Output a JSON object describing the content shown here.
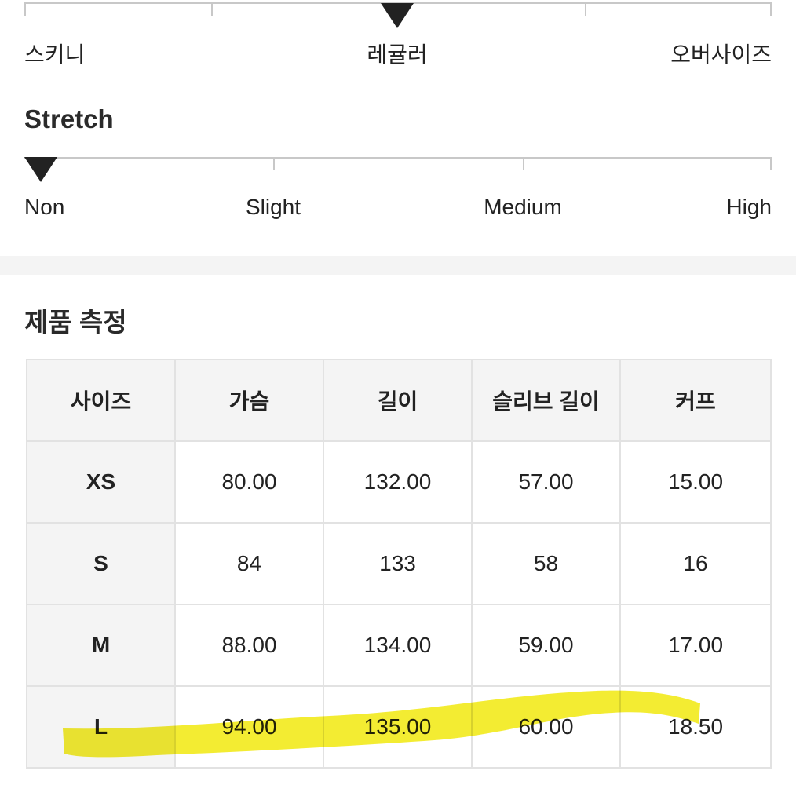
{
  "fit_scale": {
    "labels": [
      "스키니",
      "레귤러",
      "오버사이즈"
    ],
    "selected_index": 1
  },
  "stretch": {
    "title": "Stretch",
    "labels": [
      "Non",
      "Slight",
      "Medium",
      "High"
    ],
    "selected_index": 0
  },
  "measurements": {
    "title": "제품 측정",
    "headers": [
      "사이즈",
      "가슴",
      "길이",
      "슬리브 길이",
      "커프"
    ],
    "rows": [
      {
        "size": "XS",
        "values": [
          "80.00",
          "132.00",
          "57.00",
          "15.00"
        ]
      },
      {
        "size": "S",
        "values": [
          "84",
          "133",
          "58",
          "16"
        ]
      },
      {
        "size": "M",
        "values": [
          "88.00",
          "134.00",
          "59.00",
          "17.00"
        ]
      },
      {
        "size": "L",
        "values": [
          "94.00",
          "135.00",
          "60.00",
          "18.50"
        ]
      }
    ],
    "highlighted_row": "L",
    "highlight_color": "#f2ea1c"
  },
  "colors": {
    "marker": "#222222",
    "track": "#c8c8c8",
    "header_bg": "#f4f4f4",
    "border": "#e2e2e2"
  }
}
